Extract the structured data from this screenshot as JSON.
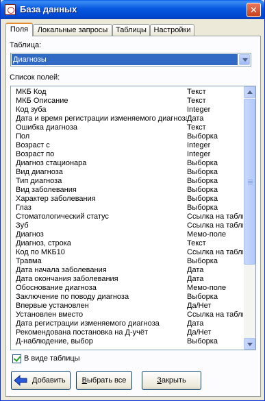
{
  "window": {
    "title": "База данных",
    "close_glyph": "✕",
    "app_icon": "database-app-icon"
  },
  "tabs": [
    {
      "label": "Поля",
      "active": true
    },
    {
      "label": "Локальные запросы",
      "active": false
    },
    {
      "label": "Таблицы",
      "active": false
    },
    {
      "label": "Настройки",
      "active": false
    }
  ],
  "table_select": {
    "label": "Таблица:",
    "value": "Диагнозы"
  },
  "fields_list": {
    "label": "Список полей:",
    "rows": [
      {
        "name": "МКБ Код",
        "type": "Текст"
      },
      {
        "name": "МКБ Описание",
        "type": "Текст"
      },
      {
        "name": "Код зуба",
        "type": "Integer"
      },
      {
        "name": "Дата и время регистрации изменяемого диагноза",
        "type": "Дата"
      },
      {
        "name": "Ошибка диагноза",
        "type": "Текст"
      },
      {
        "name": "Пол",
        "type": "Выборка"
      },
      {
        "name": "Возраст с",
        "type": "Integer"
      },
      {
        "name": "Возраст по",
        "type": "Integer"
      },
      {
        "name": "Диагноз стационара",
        "type": "Выборка"
      },
      {
        "name": "Вид диагноза",
        "type": "Выборка"
      },
      {
        "name": "Тип диагноза",
        "type": "Выборка"
      },
      {
        "name": "Вид заболевания",
        "type": "Выборка"
      },
      {
        "name": "Характер заболевания",
        "type": "Выборка"
      },
      {
        "name": "Глаз",
        "type": "Выборка"
      },
      {
        "name": "Стоматологический статус",
        "type": "Ссылка на таблицу"
      },
      {
        "name": "Зуб",
        "type": "Ссылка на таблицу"
      },
      {
        "name": "Диагноз",
        "type": "Мемо-поле"
      },
      {
        "name": "Диагноз, строка",
        "type": "Текст"
      },
      {
        "name": "Код по МКБ10",
        "type": "Ссылка на таблицу"
      },
      {
        "name": "Травма",
        "type": "Выборка"
      },
      {
        "name": "Дата начала заболевания",
        "type": "Дата"
      },
      {
        "name": "Дата окончания заболевания",
        "type": "Дата"
      },
      {
        "name": "Обоснование диагноза",
        "type": "Мемо-поле"
      },
      {
        "name": "Заключение по поводу диагноза",
        "type": "Выборка"
      },
      {
        "name": "Впервые установлен",
        "type": "Да/Нет"
      },
      {
        "name": "Установлен вместо",
        "type": "Ссылка на таблицу"
      },
      {
        "name": "Дата регистрации изменяемого диагноза",
        "type": "Дата"
      },
      {
        "name": "Рекомендована постановка на Д-учёт",
        "type": "Да/Нет"
      },
      {
        "name": "Д-наблюдение, выбор",
        "type": "Выборка"
      }
    ],
    "scroll_position": 0
  },
  "table_view_checkbox": {
    "label": "В виде таблицы",
    "checked": true
  },
  "buttons": {
    "add": {
      "hotkey": "Д",
      "rest": "обавить",
      "icon": "blue-left-arrow-icon"
    },
    "select_all": {
      "hotkey": "В",
      "rest": "ыбрать все"
    },
    "close": {
      "hotkey": "З",
      "rest": "акрыть"
    }
  },
  "colors": {
    "title_bar": "#0a5ee8",
    "selection": "#316ac5",
    "active_tab_accent": "#e68b2c",
    "check": "#21a121"
  }
}
